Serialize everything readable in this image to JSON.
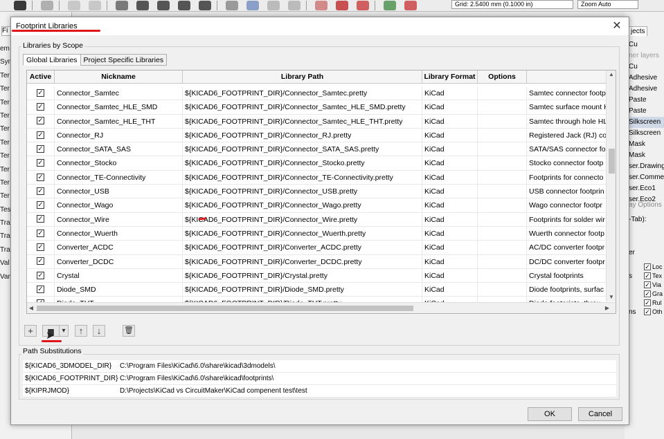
{
  "background_app": {
    "grid_select_value": "Grid: 2.5400 mm (0.1000 in)",
    "zoom_select_value": "Zoom Auto",
    "left_tab_label": "Fi",
    "left_items": [
      "em",
      "Sym",
      "Ter",
      "Ter",
      "Ter",
      "Ter",
      "Ter",
      "Ter",
      "Ter",
      "Ter",
      "Ter",
      "Ter",
      "Tes",
      "Tra",
      "Tra",
      "Tra",
      "Val",
      "Var"
    ],
    "right_panel": {
      "layers_tab": "jects",
      "layers": [
        {
          "label": "Cu",
          "state": "normal"
        },
        {
          "label": "ner layers",
          "state": "dim"
        },
        {
          "label": "Cu",
          "state": "normal"
        },
        {
          "label": "Adhesive",
          "state": "normal"
        },
        {
          "label": "Adhesive",
          "state": "normal"
        },
        {
          "label": "Paste",
          "state": "normal"
        },
        {
          "label": "Paste",
          "state": "normal"
        },
        {
          "label": "Silkscreen",
          "state": "selected"
        },
        {
          "label": "Silkscreen",
          "state": "normal"
        },
        {
          "label": "Mask",
          "state": "normal"
        },
        {
          "label": "Mask",
          "state": "normal"
        },
        {
          "label": "ser.Drawings",
          "state": "normal"
        },
        {
          "label": "ser.Comments",
          "state": "normal"
        },
        {
          "label": "ser.Eco1",
          "state": "normal"
        },
        {
          "label": "ser.Eco2",
          "state": "normal"
        }
      ],
      "display_options_label": "ay Options",
      "tab_hint": "-Tab):",
      "objects_section_label": "er",
      "object_side_labels": [
        "s",
        "ns"
      ],
      "objects": [
        "Loc",
        "Tex",
        "Via",
        "Gra",
        "Rul",
        "Oth"
      ]
    }
  },
  "dialog": {
    "title": "Footprint Libraries",
    "close_glyph": "✕",
    "libraries_by_scope_label": "Libraries by Scope",
    "tabs": [
      {
        "label": "Global Libraries",
        "active": true
      },
      {
        "label": "Project Specific Libraries",
        "active": false
      }
    ],
    "table": {
      "columns": [
        "Active",
        "Nickname",
        "Library Path",
        "Library Format",
        "Options",
        ""
      ],
      "rows": [
        {
          "active": true,
          "nickname": "Connector_Samtec",
          "path": "${KICAD6_FOOTPRINT_DIR}/Connector_Samtec.pretty",
          "format": "KiCad",
          "options": "",
          "description": "Samtec connector footp"
        },
        {
          "active": true,
          "nickname": "Connector_Samtec_HLE_SMD",
          "path": "${KICAD6_FOOTPRINT_DIR}/Connector_Samtec_HLE_SMD.pretty",
          "format": "KiCad",
          "options": "",
          "description": "Samtec surface mount H"
        },
        {
          "active": true,
          "nickname": "Connector_Samtec_HLE_THT",
          "path": "${KICAD6_FOOTPRINT_DIR}/Connector_Samtec_HLE_THT.pretty",
          "format": "KiCad",
          "options": "",
          "description": "Samtec through hole HL"
        },
        {
          "active": true,
          "nickname": "Connector_RJ",
          "path": "${KICAD6_FOOTPRINT_DIR}/Connector_RJ.pretty",
          "format": "KiCad",
          "options": "",
          "description": "Registered Jack (RJ) con"
        },
        {
          "active": true,
          "nickname": "Connector_SATA_SAS",
          "path": "${KICAD6_FOOTPRINT_DIR}/Connector_SATA_SAS.pretty",
          "format": "KiCad",
          "options": "",
          "description": "SATA/SAS connector fo"
        },
        {
          "active": true,
          "nickname": "Connector_Stocko",
          "path": "${KICAD6_FOOTPRINT_DIR}/Connector_Stocko.pretty",
          "format": "KiCad",
          "options": "",
          "description": "Stocko connector footp"
        },
        {
          "active": true,
          "nickname": "Connector_TE-Connectivity",
          "path": "${KICAD6_FOOTPRINT_DIR}/Connector_TE-Connectivity.pretty",
          "format": "KiCad",
          "options": "",
          "description": "Footprints for connecto"
        },
        {
          "active": true,
          "nickname": "Connector_USB",
          "path": "${KICAD6_FOOTPRINT_DIR}/Connector_USB.pretty",
          "format": "KiCad",
          "options": "",
          "description": "USB connector footprin"
        },
        {
          "active": true,
          "nickname": "Connector_Wago",
          "path": "${KICAD6_FOOTPRINT_DIR}/Connector_Wago.pretty",
          "format": "KiCad",
          "options": "",
          "description": "Wago connector footpr"
        },
        {
          "active": true,
          "nickname": "Connector_Wire",
          "path": "${KICAD6_FOOTPRINT_DIR}/Connector_Wire.pretty",
          "format": "KiCad",
          "options": "",
          "description": "Footprints for solder wir"
        },
        {
          "active": true,
          "nickname": "Connector_Wuerth",
          "path": "${KICAD6_FOOTPRINT_DIR}/Connector_Wuerth.pretty",
          "format": "KiCad",
          "options": "",
          "description": "Wuerth connector footp"
        },
        {
          "active": true,
          "nickname": "Converter_ACDC",
          "path": "${KICAD6_FOOTPRINT_DIR}/Converter_ACDC.pretty",
          "format": "KiCad",
          "options": "",
          "description": "AC/DC converter footpr"
        },
        {
          "active": true,
          "nickname": "Converter_DCDC",
          "path": "${KICAD6_FOOTPRINT_DIR}/Converter_DCDC.pretty",
          "format": "KiCad",
          "options": "",
          "description": "DC/DC converter footpr"
        },
        {
          "active": true,
          "nickname": "Crystal",
          "path": "${KICAD6_FOOTPRINT_DIR}/Crystal.pretty",
          "format": "KiCad",
          "options": "",
          "description": "Crystal footprints"
        },
        {
          "active": true,
          "nickname": "Diode_SMD",
          "path": "${KICAD6_FOOTPRINT_DIR}/Diode_SMD.pretty",
          "format": "KiCad",
          "options": "",
          "description": "Diode footprints, surfac"
        },
        {
          "active": true,
          "nickname": "Diode_THT",
          "path": "${KICAD6_FOOTPRINT_DIR}/Diode_THT.pretty",
          "format": "KiCad",
          "options": "",
          "description": "Diode footprints, throu"
        }
      ]
    },
    "toolbar": {
      "add_glyph": "+",
      "folder_glyph": "▆",
      "dropdown_glyph": "▾",
      "move_up_glyph": "↑",
      "move_down_glyph": "↓",
      "delete_glyph": "🗑"
    },
    "path_substitutions": {
      "label": "Path Substitutions",
      "rows": [
        {
          "name": "${KICAD6_3DMODEL_DIR}",
          "value": "C:\\Program Files\\KiCad\\6.0\\share\\kicad\\3dmodels\\"
        },
        {
          "name": "${KICAD6_FOOTPRINT_DIR}",
          "value": "C:\\Program Files\\KiCad\\6.0\\share\\kicad\\footprints\\"
        },
        {
          "name": "${KIPRJMOD}",
          "value": "D:\\Projects\\KiCad vs CircuitMaker\\KiCad compenent test\\test"
        }
      ]
    },
    "ok_label": "OK",
    "cancel_label": "Cancel",
    "annotation_color": "#e0141b"
  }
}
